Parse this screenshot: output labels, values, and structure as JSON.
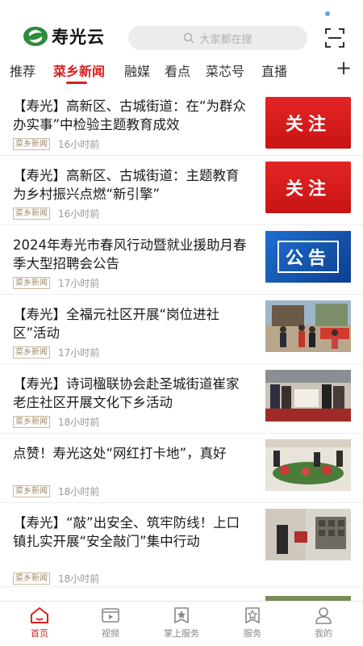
{
  "app": {
    "name": "寿光云"
  },
  "search": {
    "placeholder": "大家都在搜"
  },
  "tabs": [
    {
      "label": "推荐",
      "active": false
    },
    {
      "label": "菜乡新闻",
      "active": true
    },
    {
      "label": "融媒",
      "active": false
    },
    {
      "label": "看点",
      "active": false
    },
    {
      "label": "菜芯号",
      "active": false
    },
    {
      "label": "直播",
      "active": false
    }
  ],
  "colors": {
    "accent": "#d9201f",
    "brand_green": "#2e8b3a"
  },
  "news": [
    {
      "title": "【寿光】高新区、古城街道：在“为群众办实事”中检验主题教育成效",
      "tag": "菜乡新闻",
      "time": "16小时前",
      "thumb_text": "关注"
    },
    {
      "title": "【寿光】高新区、古城街道：主题教育为乡村振兴点燃“新引擎”",
      "tag": "菜乡新闻",
      "time": "16小时前",
      "thumb_text": "关注"
    },
    {
      "title": "2024年寿光市春风行动暨就业援助月春季大型招聘会公告",
      "tag": "菜乡新闻",
      "time": "17小时前",
      "thumb_text": "公告"
    },
    {
      "title": "【寿光】全福元社区开展“岗位进社区”活动",
      "tag": "菜乡新闻",
      "time": "17小时前"
    },
    {
      "title": "【寿光】诗词楹联协会赴圣城街道崔家老庄社区开展文化下乡活动",
      "tag": "菜乡新闻",
      "time": "18小时前"
    },
    {
      "title": "点赞！寿光这处“网红打卡地”，真好",
      "tag": "菜乡新闻",
      "time": "18小时前"
    },
    {
      "title": "【寿光】“敲”出安全、筑牢防线！上口镇扎实开展“安全敲门”集中行动",
      "tag": "菜乡新闻",
      "time": "18小时前"
    }
  ],
  "bottom_nav": [
    {
      "label": "首页",
      "icon": "home-icon",
      "active": true
    },
    {
      "label": "视频",
      "icon": "video-icon",
      "active": false
    },
    {
      "label": "掌上服务",
      "icon": "service-star-icon",
      "active": false
    },
    {
      "label": "服务",
      "icon": "star-card-icon",
      "active": false
    },
    {
      "label": "我的",
      "icon": "user-icon",
      "active": false
    }
  ]
}
